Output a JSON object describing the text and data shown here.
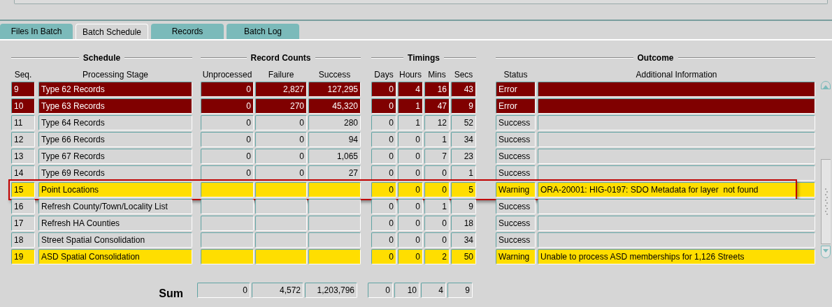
{
  "tabs": [
    {
      "label": "Files In Batch",
      "selected": false
    },
    {
      "label": "Batch Schedule",
      "selected": true
    },
    {
      "label": "Records",
      "selected": false
    },
    {
      "label": "Batch Log",
      "selected": false
    }
  ],
  "groups": [
    "Schedule",
    "Record Counts",
    "Timings",
    "Outcome"
  ],
  "columns": [
    "Seq.",
    "Processing Stage",
    "Unprocessed",
    "Failure",
    "Success",
    "Days",
    "Hours",
    "Mins",
    "Secs",
    "Status",
    "Additional Information"
  ],
  "rows": [
    {
      "kind": "error",
      "highlighted": false,
      "cells": [
        "9",
        "Type 62 Records",
        "0",
        "2,827",
        "127,295",
        "0",
        "4",
        "16",
        "43",
        "Error",
        ""
      ]
    },
    {
      "kind": "error",
      "highlighted": false,
      "cells": [
        "10",
        "Type 63 Records",
        "0",
        "270",
        "45,320",
        "0",
        "1",
        "47",
        "9",
        "Error",
        ""
      ]
    },
    {
      "kind": "success",
      "highlighted": false,
      "cells": [
        "11",
        "Type 64 Records",
        "0",
        "0",
        "280",
        "0",
        "1",
        "12",
        "52",
        "Success",
        ""
      ]
    },
    {
      "kind": "success",
      "highlighted": false,
      "cells": [
        "12",
        "Type 66 Records",
        "0",
        "0",
        "94",
        "0",
        "0",
        "1",
        "34",
        "Success",
        ""
      ]
    },
    {
      "kind": "success",
      "highlighted": false,
      "cells": [
        "13",
        "Type 67 Records",
        "0",
        "0",
        "1,065",
        "0",
        "0",
        "7",
        "23",
        "Success",
        ""
      ]
    },
    {
      "kind": "success",
      "highlighted": false,
      "cells": [
        "14",
        "Type 69 Records",
        "0",
        "0",
        "27",
        "0",
        "0",
        "0",
        "1",
        "Success",
        ""
      ]
    },
    {
      "kind": "warning",
      "highlighted": true,
      "cells": [
        "15",
        "Point Locations",
        "",
        "",
        "",
        "0",
        "0",
        "0",
        "5",
        "Warning",
        "ORA-20001: HIG-0197: SDO Metadata for layer  not found"
      ]
    },
    {
      "kind": "success",
      "highlighted": false,
      "cells": [
        "16",
        "Refresh County/Town/Locality List",
        "",
        "",
        "",
        "0",
        "0",
        "1",
        "9",
        "Success",
        ""
      ]
    },
    {
      "kind": "success",
      "highlighted": false,
      "cells": [
        "17",
        "Refresh HA Counties",
        "",
        "",
        "",
        "0",
        "0",
        "0",
        "18",
        "Success",
        ""
      ]
    },
    {
      "kind": "success",
      "highlighted": false,
      "cells": [
        "18",
        "Street Spatial Consolidation",
        "",
        "",
        "",
        "0",
        "0",
        "0",
        "34",
        "Success",
        ""
      ]
    },
    {
      "kind": "warning",
      "highlighted": false,
      "cells": [
        "19",
        "ASD Spatial Consolidation",
        "",
        "",
        "",
        "0",
        "0",
        "2",
        "50",
        "Warning",
        "Unable to process ASD memberships for 1,126 Streets"
      ]
    }
  ],
  "sum": {
    "label": "Sum",
    "cells": [
      "0",
      "4,572",
      "1,203,796",
      "0",
      "10",
      "4",
      "9"
    ]
  }
}
